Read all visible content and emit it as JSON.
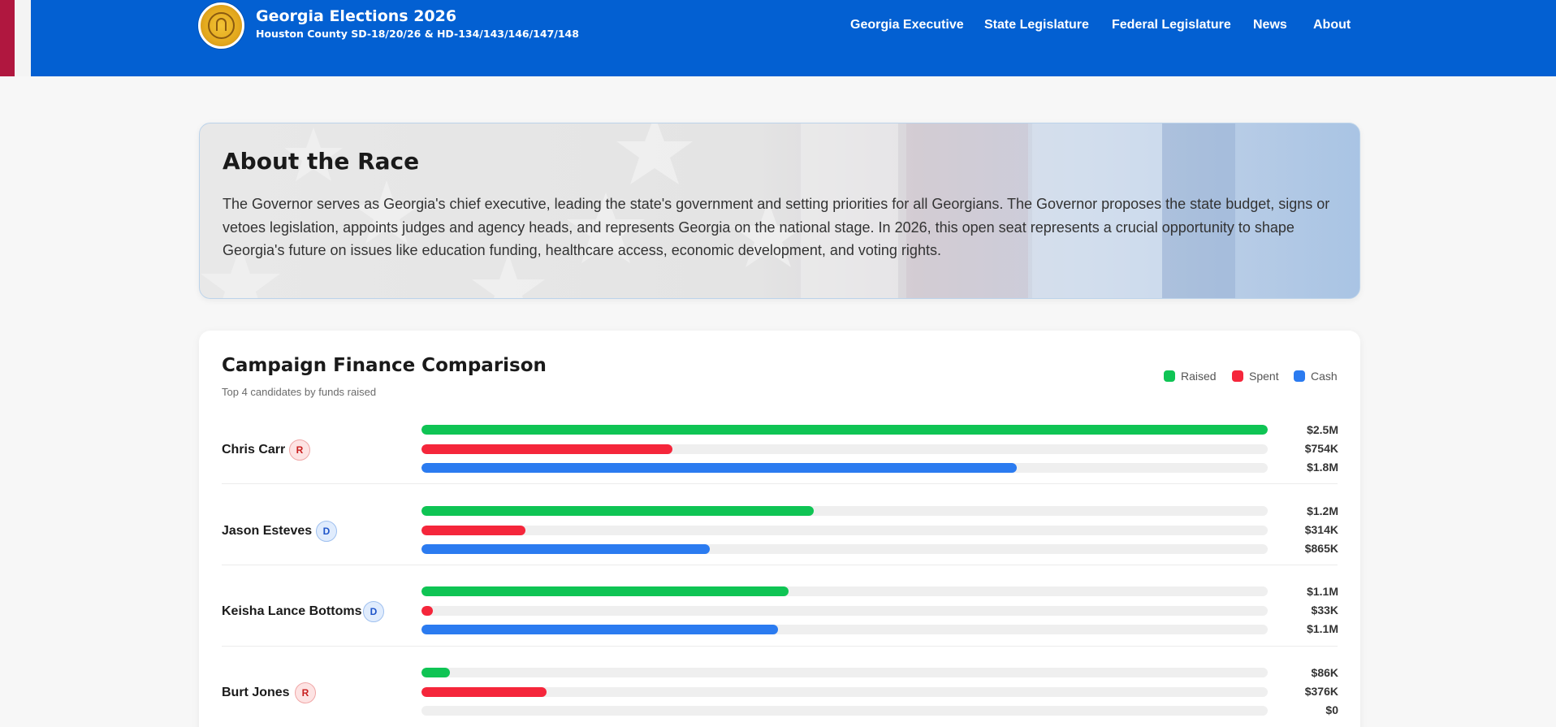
{
  "header": {
    "title": "Georgia Elections 2026",
    "subtitle": "Houston County SD-18/20/26 & HD-134/143/146/147/148",
    "nav": [
      "Georgia Executive",
      "State Legislature",
      "Federal Legislature",
      "News",
      "About"
    ]
  },
  "about": {
    "title": "About the Race",
    "text": "The Governor serves as Georgia's chief executive, leading the state's government and setting priorities for all Georgians. The Governor proposes the state budget, signs or vetoes legislation, appoints judges and agency heads, and represents Georgia on the national stage. In 2026, this open seat represents a crucial opportunity to shape Georgia's future on issues like education funding, healthcare access, economic development, and voting rights."
  },
  "finance": {
    "title": "Campaign Finance Comparison",
    "subtitle": "Top 4 candidates by funds raised",
    "legend": [
      "Raised",
      "Spent",
      "Cash"
    ],
    "colors": {
      "raised": "#0fc454",
      "spent": "#f5263b",
      "cash": "#2b7bf0"
    },
    "candidates": [
      {
        "name": "Chris Carr",
        "party": "R",
        "raised": {
          "label": "$2.5M",
          "fraction": 1.0
        },
        "spent": {
          "label": "$754K",
          "fraction": 0.297
        },
        "cash": {
          "label": "$1.8M",
          "fraction": 0.703
        }
      },
      {
        "name": "Jason Esteves",
        "party": "D",
        "raised": {
          "label": "$1.2M",
          "fraction": 0.464
        },
        "spent": {
          "label": "$314K",
          "fraction": 0.123
        },
        "cash": {
          "label": "$865K",
          "fraction": 0.341
        }
      },
      {
        "name": "Keisha Lance Bottoms",
        "party": "D",
        "raised": {
          "label": "$1.1M",
          "fraction": 0.434
        },
        "spent": {
          "label": "$33K",
          "fraction": 0.013
        },
        "cash": {
          "label": "$1.1M",
          "fraction": 0.421
        }
      },
      {
        "name": "Burt Jones",
        "party": "R",
        "raised": {
          "label": "$86K",
          "fraction": 0.034
        },
        "spent": {
          "label": "$376K",
          "fraction": 0.148
        },
        "cash": {
          "label": "$0",
          "fraction": 0.0
        }
      }
    ]
  }
}
